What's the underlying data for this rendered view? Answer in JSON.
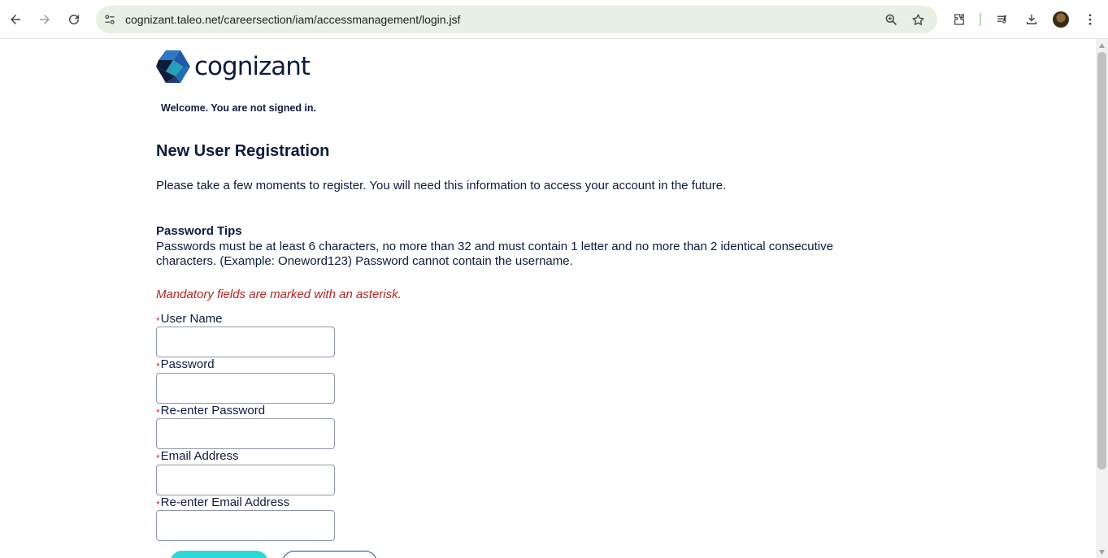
{
  "browser": {
    "url": "cognizant.taleo.net/careersection/iam/accessmanagement/login.jsf"
  },
  "header": {
    "logo_text": "cognizant",
    "welcome": "Welcome. You are not signed in."
  },
  "main": {
    "title": "New User Registration",
    "intro": "Please take a few moments to register. You will need this information to access your account in the future.",
    "tips_title": "Password Tips",
    "tips_body": "Passwords must be at least 6 characters, no more than 32 and must contain 1 letter and no more than 2 identical consecutive characters. (Example: Oneword123) Password cannot contain the username.",
    "mandatory_note": "Mandatory fields are marked with an asterisk.",
    "asterisk": "*",
    "fields": [
      {
        "label": "User Name",
        "value": ""
      },
      {
        "label": "Password",
        "value": ""
      },
      {
        "label": "Re-enter Password",
        "value": ""
      },
      {
        "label": "Email Address",
        "value": ""
      },
      {
        "label": "Re-enter Email Address",
        "value": ""
      }
    ]
  },
  "colors": {
    "brand_navy": "#0d1b3e",
    "mandatory_red": "#b42323",
    "primary_button": "#2ed8d8",
    "omnibox_bg": "#e8efe3"
  }
}
